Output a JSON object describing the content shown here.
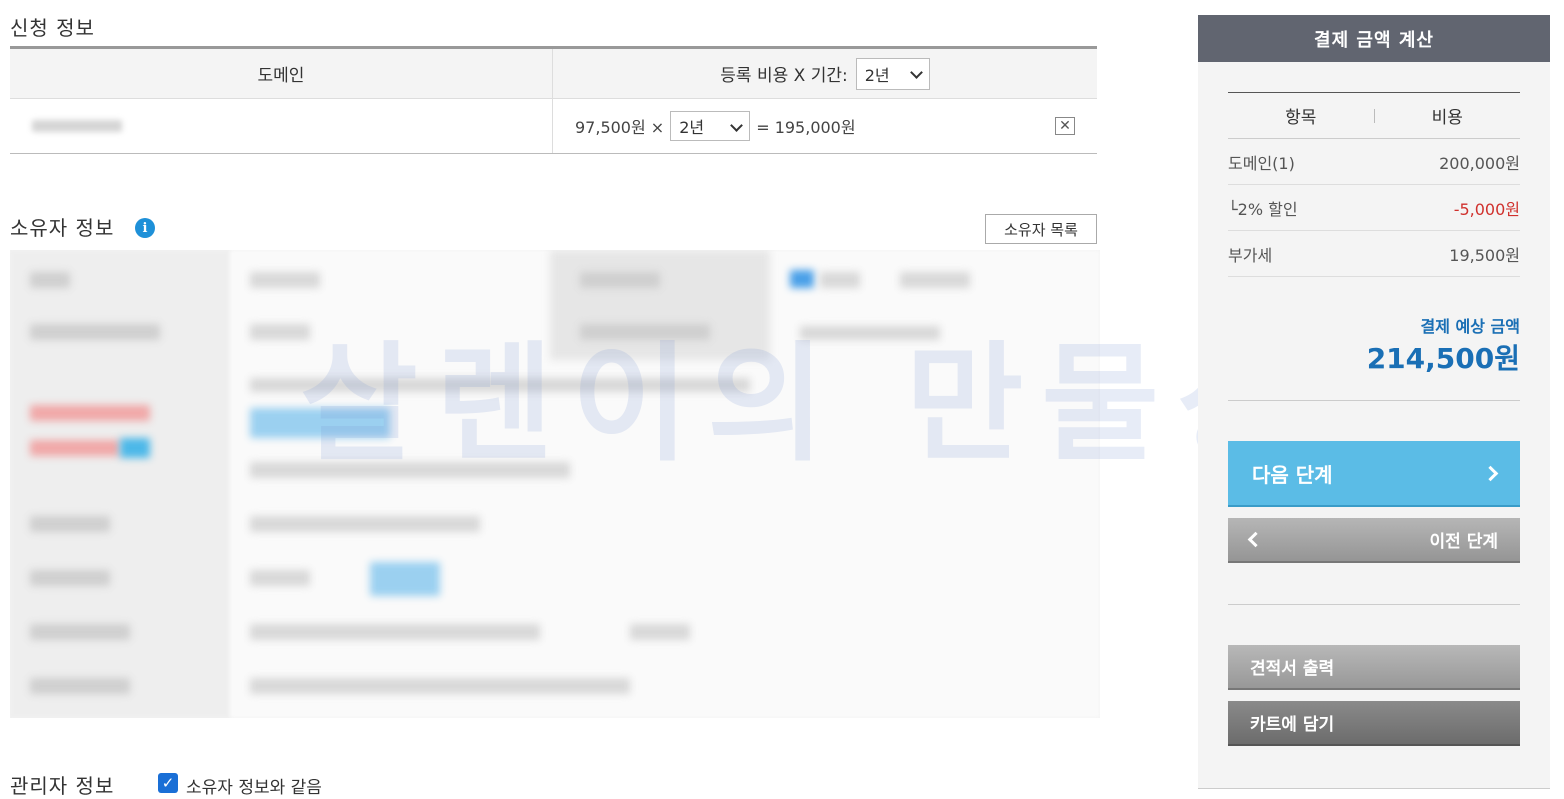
{
  "application": {
    "title": "신청 정보",
    "col_domain": "도메인",
    "col_fee": "등록 비용 X 기간:",
    "period_header_value": "2년",
    "row": {
      "unit_price": "97,500원 ×",
      "period_value": "2년",
      "total": "= 195,000원",
      "delete_symbol": "✕"
    }
  },
  "owner": {
    "title": "소유자 정보",
    "info_symbol": "i",
    "list_button": "소유자 목록"
  },
  "watermark": "살렌이의 만물상",
  "admin": {
    "title": "관리자 정보",
    "checked": true,
    "check_mark": "✓",
    "check_label": "소유자 정보와 같음"
  },
  "sidebar": {
    "title": "결제 금액 계산",
    "col_item": "항목",
    "col_cost": "비용",
    "rows": [
      {
        "label": "도메인(1)",
        "value": "200,000원"
      },
      {
        "label": "└2% 할인",
        "value": "-5,000원"
      },
      {
        "label": "부가세",
        "value": "19,500원"
      }
    ],
    "total_label": "결제 예상 금액",
    "total_value": "214,500원",
    "next_button": "다음 단계",
    "prev_button": "이전 단계",
    "quote_button": "견적서 출력",
    "cart_button": "카트에 담기"
  },
  "colors": {
    "accent_blue": "#1a6fb5",
    "next_button": "#5bbce6",
    "discount_red": "#d0312d",
    "sidebar_header": "#616570"
  }
}
